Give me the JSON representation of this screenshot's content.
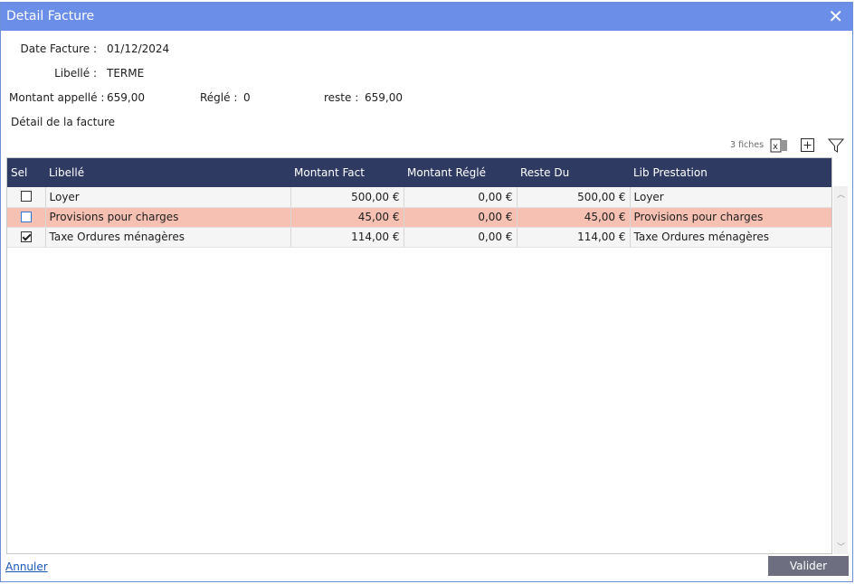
{
  "window": {
    "title": "Detail Facture"
  },
  "info": {
    "date_label": "Date Facture :",
    "date_value": "01/12/2024",
    "libelle_label": "Libellé :",
    "libelle_value": "TERME",
    "montant_label": "Montant appellé :",
    "montant_value": "659,00",
    "regle_label": "Réglé :",
    "regle_value": "0",
    "reste_label": "reste :",
    "reste_value": "659,00",
    "detail_heading": "Détail de la facture"
  },
  "toolbar": {
    "count": "3 fiches",
    "icons": [
      "excel-export-icon",
      "add-icon",
      "filter-icon"
    ]
  },
  "table": {
    "columns": [
      "Sel",
      "Libellé",
      "Montant Fact",
      "Montant Réglé",
      "Reste Du",
      "Lib Prestation"
    ],
    "rows": [
      {
        "sel": false,
        "libelle": "Loyer",
        "montant_fact": "500,00 €",
        "montant_regle": "0,00 €",
        "reste_du": "500,00 €",
        "lib_prestation": "Loyer",
        "highlight": false
      },
      {
        "sel": false,
        "libelle": "Provisions pour charges",
        "montant_fact": "45,00 €",
        "montant_regle": "0,00 €",
        "reste_du": "45,00 €",
        "lib_prestation": "Provisions pour charges",
        "highlight": true
      },
      {
        "sel": true,
        "libelle": "Taxe Ordures ménagères",
        "montant_fact": "114,00 €",
        "montant_regle": "0,00 €",
        "reste_du": "114,00 €",
        "lib_prestation": "Taxe Ordures ménagères",
        "highlight": false
      }
    ]
  },
  "footer": {
    "cancel_label": "Annuler",
    "validate_label": "Valider"
  },
  "colors": {
    "titlebar": "#6b8fe8",
    "header": "#2f3a63",
    "highlight_row": "#f6c1b3",
    "validate_button": "#6d6f80"
  }
}
